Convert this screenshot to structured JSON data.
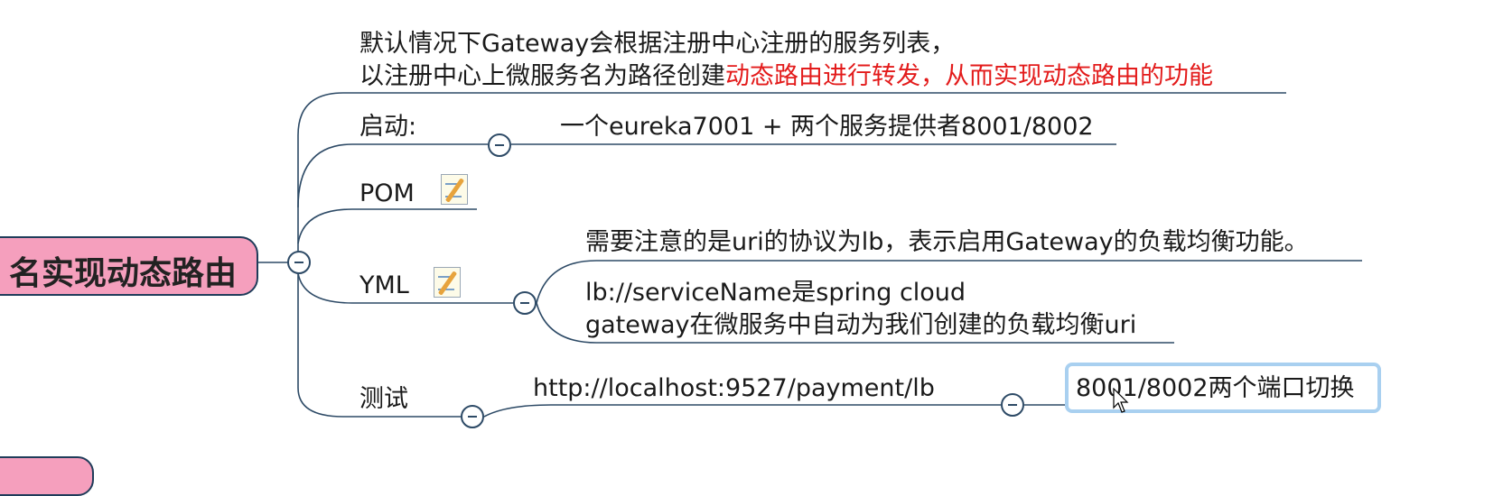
{
  "root": {
    "label": "名实现动态路由"
  },
  "intro": {
    "line1": "默认情况下Gateway会根据注册中心注册的服务列表，",
    "line2_black": "以注册中心上微服务名为路径创建",
    "line2_red": "动态路由进行转发，从而实现动态路由的功能"
  },
  "startup": {
    "label": "启动:",
    "detail": "一个eureka7001 + 两个服务提供者8001/8002"
  },
  "pom": {
    "label": "POM",
    "icon": "note-icon"
  },
  "yml": {
    "label": "YML",
    "icon": "note-icon",
    "note1": "需要注意的是uri的协议为lb，表示启用Gateway的负载均衡功能。",
    "note2_line1": "lb://serviceName是spring cloud",
    "note2_line2": "gateway在微服务中自动为我们创建的负载均衡uri"
  },
  "test": {
    "label": "测试",
    "url": "http://localhost:9527/payment/lb",
    "result": "8001/8002两个端口切换"
  },
  "colors": {
    "line": "#2d4a66",
    "root_fill": "#f59fbd",
    "highlight": "#e31b1b",
    "selection": "#a9d0f0"
  }
}
